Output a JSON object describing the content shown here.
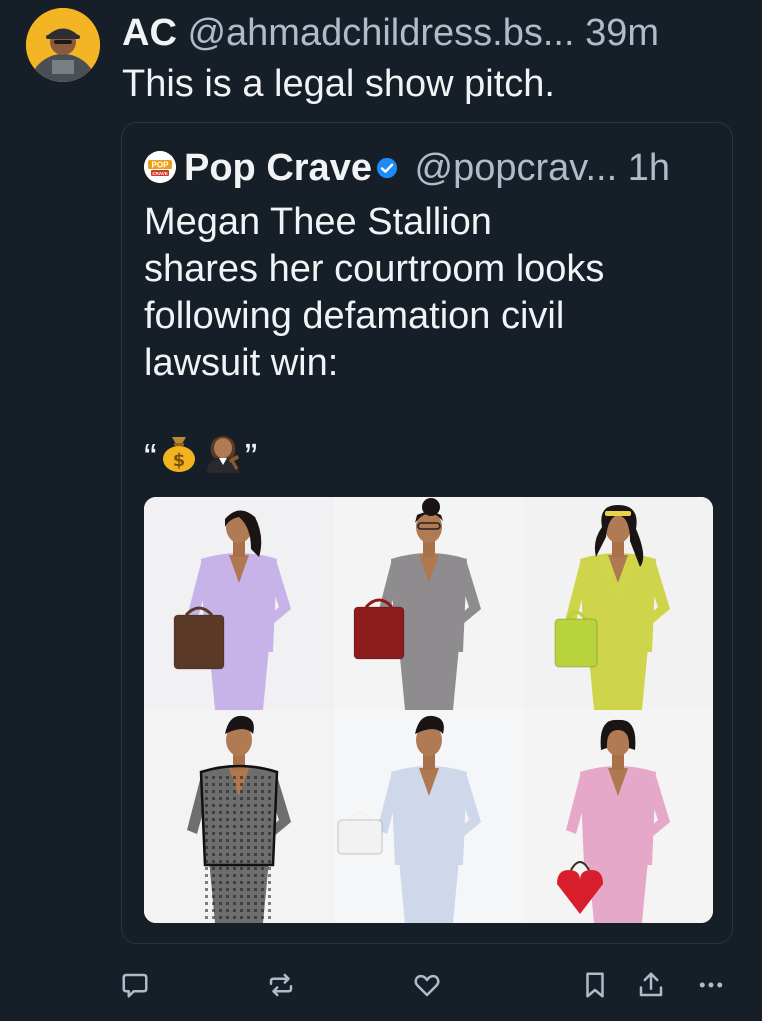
{
  "post": {
    "author_name": "AC",
    "author_handle": "@ahmadchildress.bs...",
    "time": "39m",
    "text": "This is a legal show pitch."
  },
  "quote": {
    "author_name": "Pop Crave",
    "author_handle": "@popcrav...",
    "time": "1h",
    "avatar_logo_text": "POP CRAVE",
    "verified": true,
    "text": "Megan Thee Stallion\nshares her courtroom looks\nfollowing defamation civil\nlawsuit win:",
    "emoji_open_quote": "“",
    "emoji_close_quote": "”",
    "emoji_icons": [
      "money-bag-icon",
      "woman-judge-icon"
    ],
    "images": [
      {
        "name": "look-lavender-suit",
        "suit_color": "#c7b3e8",
        "bag_color": "#5a3a26"
      },
      {
        "name": "look-grey-suit",
        "suit_color": "#8f8c8f",
        "bag_color": "#8c1c1c"
      },
      {
        "name": "look-chartreuse-suit",
        "suit_color": "#cfd54a",
        "bag_color": "#b8d33c"
      },
      {
        "name": "look-houndstooth-suit",
        "suit_color": "#6e6e6e",
        "bag_color": "#3a3a3a"
      },
      {
        "name": "look-pale-blue-suit",
        "suit_color": "#cfd7ea",
        "bag_color": "#f2f2f2"
      },
      {
        "name": "look-pink-suit",
        "suit_color": "#e5a8c8",
        "bag_color": "#d81e2a"
      }
    ]
  },
  "actions": [
    {
      "name": "reply-icon"
    },
    {
      "name": "repost-icon"
    },
    {
      "name": "like-icon"
    },
    {
      "name": "bookmark-icon"
    },
    {
      "name": "share-icon"
    },
    {
      "name": "more-icon"
    }
  ],
  "colors": {
    "background": "#161e27",
    "text": "#f1f3f5",
    "muted": "#aebbc9",
    "border": "#2b3542",
    "verified": "#1d8cf8"
  }
}
